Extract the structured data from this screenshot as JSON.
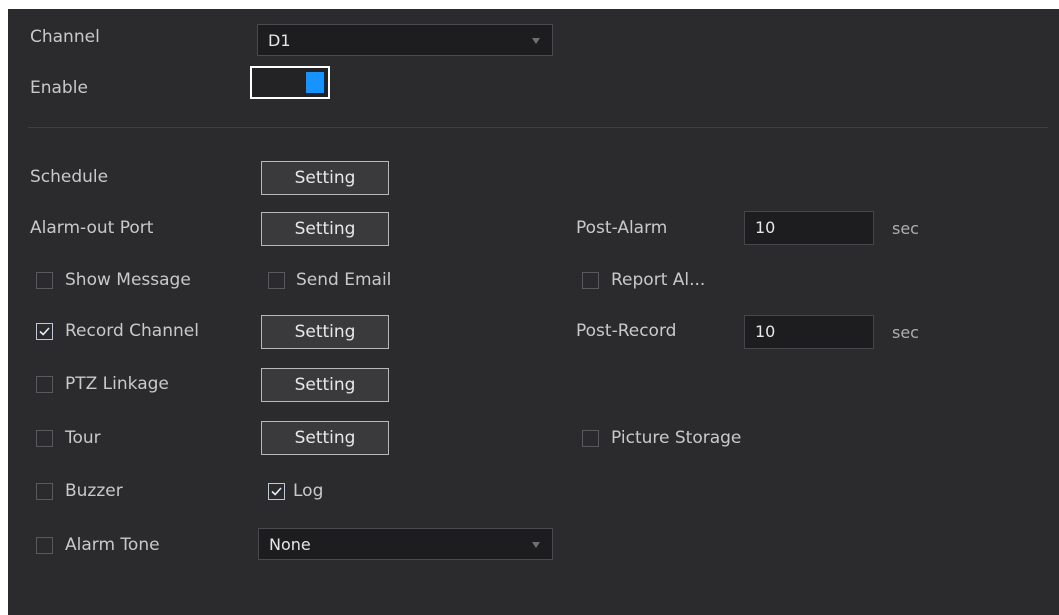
{
  "channel": {
    "label": "Channel",
    "value": "D1"
  },
  "enable": {
    "label": "Enable",
    "state": "on"
  },
  "schedule": {
    "label": "Schedule",
    "button": "Setting"
  },
  "alarm_out": {
    "label": "Alarm-out Port",
    "button": "Setting"
  },
  "post_alarm": {
    "label": "Post-Alarm",
    "value": "10",
    "unit": "sec"
  },
  "show_message": {
    "label": "Show Message",
    "checked": false
  },
  "send_email": {
    "label": "Send Email",
    "checked": false
  },
  "report_alarm": {
    "label": "Report Al...",
    "checked": false
  },
  "record_channel": {
    "label": "Record Channel",
    "checked": true,
    "button": "Setting"
  },
  "post_record": {
    "label": "Post-Record",
    "value": "10",
    "unit": "sec"
  },
  "ptz_linkage": {
    "label": "PTZ Linkage",
    "checked": false,
    "button": "Setting"
  },
  "tour": {
    "label": "Tour",
    "checked": false,
    "button": "Setting"
  },
  "picture_storage": {
    "label": "Picture Storage",
    "checked": false
  },
  "buzzer": {
    "label": "Buzzer",
    "checked": false
  },
  "log": {
    "label": "Log",
    "checked": true
  },
  "alarm_tone": {
    "label": "Alarm Tone",
    "checked": false,
    "value": "None"
  },
  "colors": {
    "background": "#2b2b2e",
    "accent": "#1693ff"
  }
}
